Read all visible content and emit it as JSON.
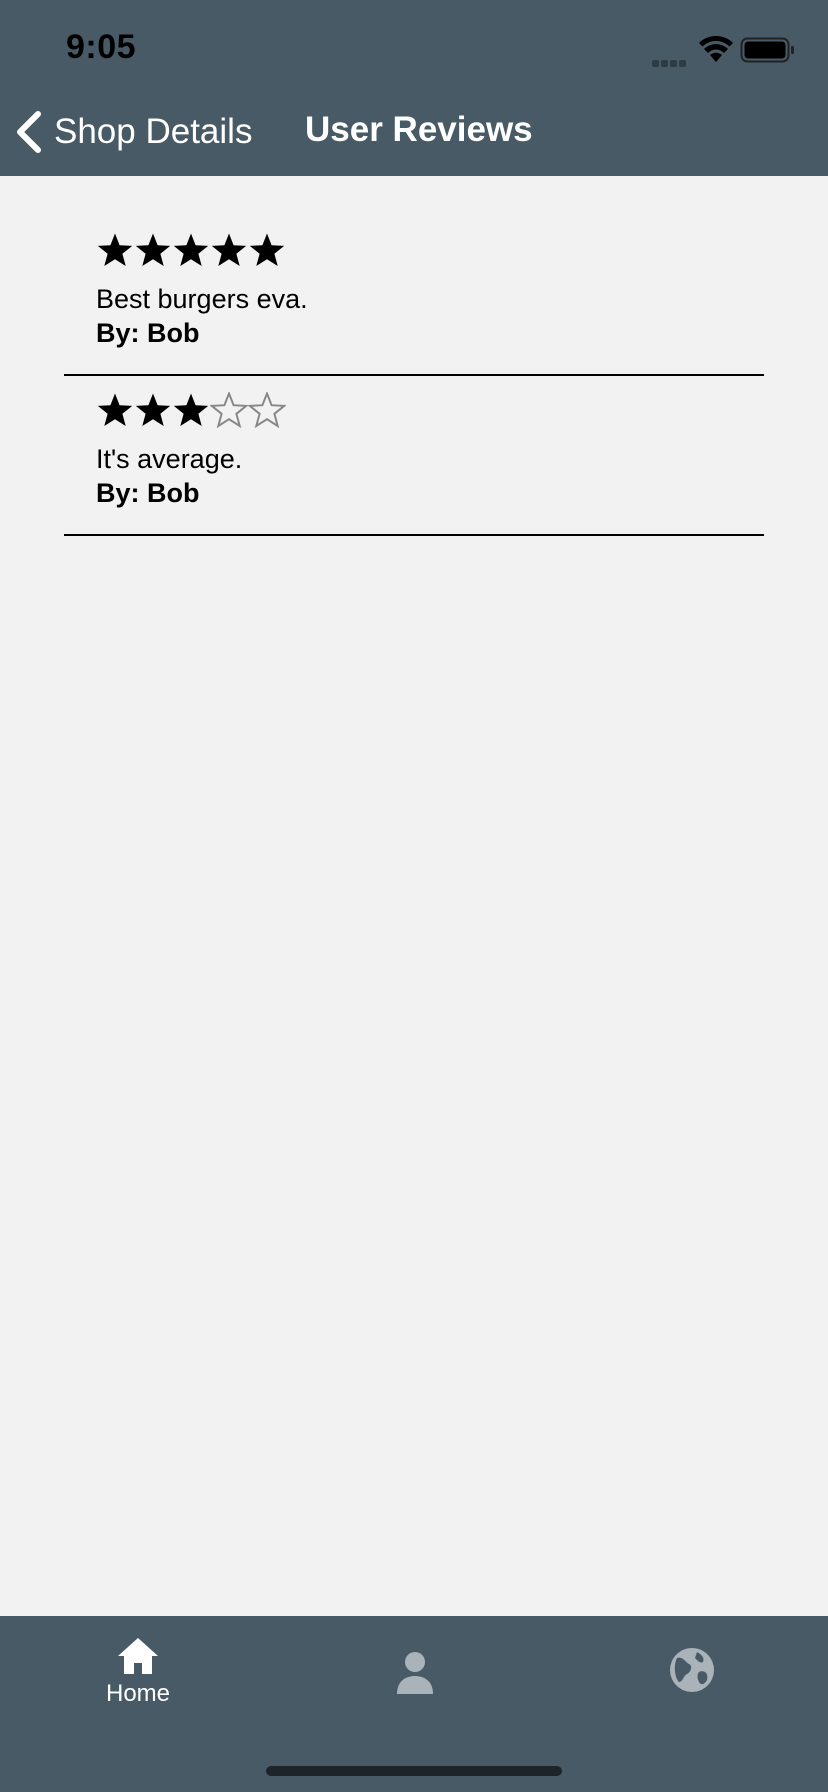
{
  "status_bar": {
    "time": "9:05"
  },
  "nav": {
    "back_label": "Shop Details",
    "title": "User Reviews"
  },
  "reviews": [
    {
      "rating": 5,
      "max_rating": 5,
      "text": "Best burgers eva.",
      "author": "By: Bob"
    },
    {
      "rating": 3,
      "max_rating": 5,
      "text": "It's average.",
      "author": "By: Bob"
    }
  ],
  "tabbar": {
    "items": [
      {
        "label": "Home",
        "icon": "home-icon",
        "active": true
      },
      {
        "label": "",
        "icon": "person-icon",
        "active": false
      },
      {
        "label": "",
        "icon": "globe-icon",
        "active": false
      }
    ]
  },
  "colors": {
    "header": "#475a66",
    "background": "#f2f2f2",
    "star_filled": "#000000",
    "star_empty": "#888888",
    "inactive_icon": "#a9b3b9"
  }
}
